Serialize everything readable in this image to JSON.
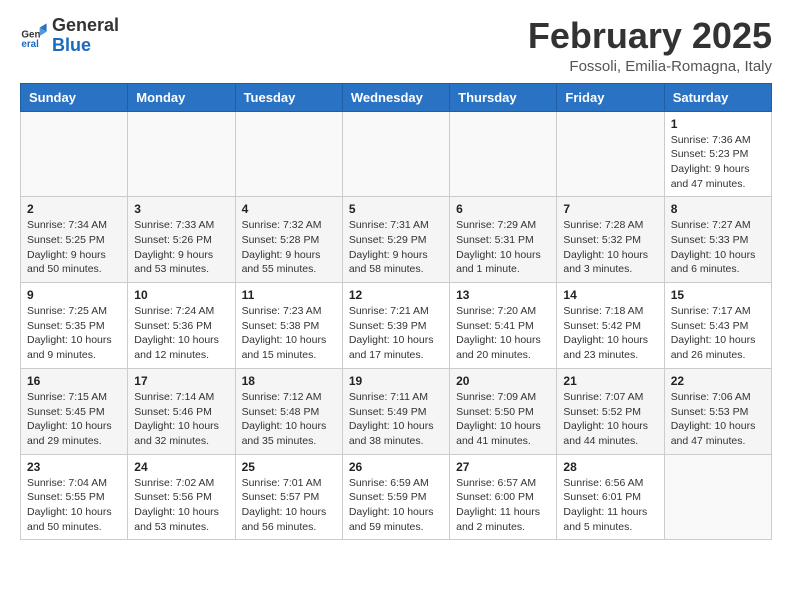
{
  "header": {
    "logo": {
      "general": "General",
      "blue": "Blue"
    },
    "title": "February 2025",
    "location": "Fossoli, Emilia-Romagna, Italy"
  },
  "calendar": {
    "days_of_week": [
      "Sunday",
      "Monday",
      "Tuesday",
      "Wednesday",
      "Thursday",
      "Friday",
      "Saturday"
    ],
    "weeks": [
      [
        {
          "day": "",
          "info": ""
        },
        {
          "day": "",
          "info": ""
        },
        {
          "day": "",
          "info": ""
        },
        {
          "day": "",
          "info": ""
        },
        {
          "day": "",
          "info": ""
        },
        {
          "day": "",
          "info": ""
        },
        {
          "day": "1",
          "info": "Sunrise: 7:36 AM\nSunset: 5:23 PM\nDaylight: 9 hours and 47 minutes."
        }
      ],
      [
        {
          "day": "2",
          "info": "Sunrise: 7:34 AM\nSunset: 5:25 PM\nDaylight: 9 hours and 50 minutes."
        },
        {
          "day": "3",
          "info": "Sunrise: 7:33 AM\nSunset: 5:26 PM\nDaylight: 9 hours and 53 minutes."
        },
        {
          "day": "4",
          "info": "Sunrise: 7:32 AM\nSunset: 5:28 PM\nDaylight: 9 hours and 55 minutes."
        },
        {
          "day": "5",
          "info": "Sunrise: 7:31 AM\nSunset: 5:29 PM\nDaylight: 9 hours and 58 minutes."
        },
        {
          "day": "6",
          "info": "Sunrise: 7:29 AM\nSunset: 5:31 PM\nDaylight: 10 hours and 1 minute."
        },
        {
          "day": "7",
          "info": "Sunrise: 7:28 AM\nSunset: 5:32 PM\nDaylight: 10 hours and 3 minutes."
        },
        {
          "day": "8",
          "info": "Sunrise: 7:27 AM\nSunset: 5:33 PM\nDaylight: 10 hours and 6 minutes."
        }
      ],
      [
        {
          "day": "9",
          "info": "Sunrise: 7:25 AM\nSunset: 5:35 PM\nDaylight: 10 hours and 9 minutes."
        },
        {
          "day": "10",
          "info": "Sunrise: 7:24 AM\nSunset: 5:36 PM\nDaylight: 10 hours and 12 minutes."
        },
        {
          "day": "11",
          "info": "Sunrise: 7:23 AM\nSunset: 5:38 PM\nDaylight: 10 hours and 15 minutes."
        },
        {
          "day": "12",
          "info": "Sunrise: 7:21 AM\nSunset: 5:39 PM\nDaylight: 10 hours and 17 minutes."
        },
        {
          "day": "13",
          "info": "Sunrise: 7:20 AM\nSunset: 5:41 PM\nDaylight: 10 hours and 20 minutes."
        },
        {
          "day": "14",
          "info": "Sunrise: 7:18 AM\nSunset: 5:42 PM\nDaylight: 10 hours and 23 minutes."
        },
        {
          "day": "15",
          "info": "Sunrise: 7:17 AM\nSunset: 5:43 PM\nDaylight: 10 hours and 26 minutes."
        }
      ],
      [
        {
          "day": "16",
          "info": "Sunrise: 7:15 AM\nSunset: 5:45 PM\nDaylight: 10 hours and 29 minutes."
        },
        {
          "day": "17",
          "info": "Sunrise: 7:14 AM\nSunset: 5:46 PM\nDaylight: 10 hours and 32 minutes."
        },
        {
          "day": "18",
          "info": "Sunrise: 7:12 AM\nSunset: 5:48 PM\nDaylight: 10 hours and 35 minutes."
        },
        {
          "day": "19",
          "info": "Sunrise: 7:11 AM\nSunset: 5:49 PM\nDaylight: 10 hours and 38 minutes."
        },
        {
          "day": "20",
          "info": "Sunrise: 7:09 AM\nSunset: 5:50 PM\nDaylight: 10 hours and 41 minutes."
        },
        {
          "day": "21",
          "info": "Sunrise: 7:07 AM\nSunset: 5:52 PM\nDaylight: 10 hours and 44 minutes."
        },
        {
          "day": "22",
          "info": "Sunrise: 7:06 AM\nSunset: 5:53 PM\nDaylight: 10 hours and 47 minutes."
        }
      ],
      [
        {
          "day": "23",
          "info": "Sunrise: 7:04 AM\nSunset: 5:55 PM\nDaylight: 10 hours and 50 minutes."
        },
        {
          "day": "24",
          "info": "Sunrise: 7:02 AM\nSunset: 5:56 PM\nDaylight: 10 hours and 53 minutes."
        },
        {
          "day": "25",
          "info": "Sunrise: 7:01 AM\nSunset: 5:57 PM\nDaylight: 10 hours and 56 minutes."
        },
        {
          "day": "26",
          "info": "Sunrise: 6:59 AM\nSunset: 5:59 PM\nDaylight: 10 hours and 59 minutes."
        },
        {
          "day": "27",
          "info": "Sunrise: 6:57 AM\nSunset: 6:00 PM\nDaylight: 11 hours and 2 minutes."
        },
        {
          "day": "28",
          "info": "Sunrise: 6:56 AM\nSunset: 6:01 PM\nDaylight: 11 hours and 5 minutes."
        },
        {
          "day": "",
          "info": ""
        }
      ]
    ]
  }
}
